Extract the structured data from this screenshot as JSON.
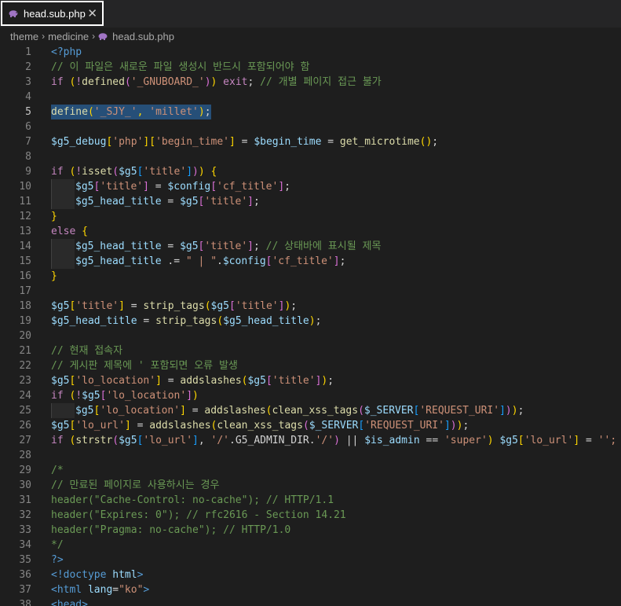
{
  "tab": {
    "filename": "head.sub.php",
    "icon": "php-elephant-icon",
    "close_glyph": "✕"
  },
  "breadcrumb": {
    "items": [
      "theme",
      "medicine",
      "head.sub.php"
    ],
    "separator": "›"
  },
  "editor": {
    "active_line": 5,
    "lines": [
      {
        "n": "1",
        "tokens": [
          [
            "<?php",
            "tag"
          ]
        ]
      },
      {
        "n": "2",
        "tokens": [
          [
            "// 이 파일은 새로운 파일 생성시 반드시 포함되어야 함",
            "cmt"
          ]
        ]
      },
      {
        "n": "3",
        "tokens": [
          [
            "if",
            "kw"
          ],
          [
            " ",
            ""
          ],
          [
            "(",
            "y"
          ],
          [
            "!",
            "kw"
          ],
          [
            "defined",
            "fn"
          ],
          [
            "(",
            "p"
          ],
          [
            "'_GNUBOARD_'",
            "str"
          ],
          [
            ")",
            "p"
          ],
          [
            ")",
            "y"
          ],
          [
            " ",
            ""
          ],
          [
            "exit",
            "kw"
          ],
          [
            "; ",
            ""
          ],
          [
            "// 개별 페이지 접근 불가",
            "cmt"
          ]
        ]
      },
      {
        "n": "4",
        "tokens": []
      },
      {
        "n": "5",
        "tokens": [
          [
            "define",
            "fn"
          ],
          [
            "(",
            "y"
          ],
          [
            "'_SJY_'",
            "str"
          ],
          [
            ",",
            "y"
          ],
          [
            " ",
            ""
          ],
          [
            "'millet'",
            "str"
          ],
          [
            ")",
            "y"
          ],
          [
            ";",
            ""
          ]
        ],
        "selected": true
      },
      {
        "n": "6",
        "tokens": []
      },
      {
        "n": "7",
        "tokens": [
          [
            "$g5_debug",
            "var"
          ],
          [
            "[",
            "y"
          ],
          [
            "'php'",
            "str"
          ],
          [
            "]",
            "y"
          ],
          [
            "[",
            "y"
          ],
          [
            "'begin_time'",
            "str"
          ],
          [
            "]",
            "y"
          ],
          [
            " = ",
            ""
          ],
          [
            "$begin_time",
            "var"
          ],
          [
            " = ",
            ""
          ],
          [
            "get_microtime",
            "fn"
          ],
          [
            "()",
            "y"
          ],
          [
            ";",
            ""
          ]
        ]
      },
      {
        "n": "8",
        "tokens": []
      },
      {
        "n": "9",
        "tokens": [
          [
            "if",
            "kw"
          ],
          [
            " ",
            ""
          ],
          [
            "(",
            "y"
          ],
          [
            "!",
            "kw"
          ],
          [
            "isset",
            "fn"
          ],
          [
            "(",
            "p"
          ],
          [
            "$g5",
            "var"
          ],
          [
            "[",
            "b"
          ],
          [
            "'title'",
            "str"
          ],
          [
            "]",
            "b"
          ],
          [
            ")",
            "p"
          ],
          [
            ")",
            "y"
          ],
          [
            " ",
            ""
          ],
          [
            "{",
            "y"
          ]
        ]
      },
      {
        "n": "10",
        "indent": 1,
        "tokens": [
          [
            "$g5",
            "var"
          ],
          [
            "[",
            "p"
          ],
          [
            "'title'",
            "str"
          ],
          [
            "]",
            "p"
          ],
          [
            " = ",
            ""
          ],
          [
            "$config",
            "var"
          ],
          [
            "[",
            "p"
          ],
          [
            "'cf_title'",
            "str"
          ],
          [
            "]",
            "p"
          ],
          [
            ";",
            ""
          ]
        ]
      },
      {
        "n": "11",
        "indent": 1,
        "tokens": [
          [
            "$g5_head_title",
            "var"
          ],
          [
            " = ",
            ""
          ],
          [
            "$g5",
            "var"
          ],
          [
            "[",
            "p"
          ],
          [
            "'title'",
            "str"
          ],
          [
            "]",
            "p"
          ],
          [
            ";",
            ""
          ]
        ]
      },
      {
        "n": "12",
        "tokens": [
          [
            "}",
            "y"
          ]
        ]
      },
      {
        "n": "13",
        "tokens": [
          [
            "else",
            "kw"
          ],
          [
            " ",
            ""
          ],
          [
            "{",
            "y"
          ]
        ]
      },
      {
        "n": "14",
        "indent": 1,
        "tokens": [
          [
            "$g5_head_title",
            "var"
          ],
          [
            " = ",
            ""
          ],
          [
            "$g5",
            "var"
          ],
          [
            "[",
            "p"
          ],
          [
            "'title'",
            "str"
          ],
          [
            "]",
            "p"
          ],
          [
            "; ",
            ""
          ],
          [
            "// 상태바에 표시될 제목",
            "cmt"
          ]
        ]
      },
      {
        "n": "15",
        "indent": 1,
        "tokens": [
          [
            "$g5_head_title",
            "var"
          ],
          [
            " .= ",
            ""
          ],
          [
            "\" | \"",
            "str"
          ],
          [
            ".",
            ""
          ],
          [
            "$config",
            "var"
          ],
          [
            "[",
            "p"
          ],
          [
            "'cf_title'",
            "str"
          ],
          [
            "]",
            "p"
          ],
          [
            ";",
            ""
          ]
        ]
      },
      {
        "n": "16",
        "tokens": [
          [
            "}",
            "y"
          ]
        ]
      },
      {
        "n": "17",
        "tokens": []
      },
      {
        "n": "18",
        "tokens": [
          [
            "$g5",
            "var"
          ],
          [
            "[",
            "y"
          ],
          [
            "'title'",
            "str"
          ],
          [
            "]",
            "y"
          ],
          [
            " = ",
            ""
          ],
          [
            "strip_tags",
            "fn"
          ],
          [
            "(",
            "y"
          ],
          [
            "$g5",
            "var"
          ],
          [
            "[",
            "p"
          ],
          [
            "'title'",
            "str"
          ],
          [
            "]",
            "p"
          ],
          [
            ")",
            "y"
          ],
          [
            ";",
            ""
          ]
        ]
      },
      {
        "n": "19",
        "tokens": [
          [
            "$g5_head_title",
            "var"
          ],
          [
            " = ",
            ""
          ],
          [
            "strip_tags",
            "fn"
          ],
          [
            "(",
            "y"
          ],
          [
            "$g5_head_title",
            "var"
          ],
          [
            ")",
            "y"
          ],
          [
            ";",
            ""
          ]
        ]
      },
      {
        "n": "20",
        "tokens": []
      },
      {
        "n": "21",
        "tokens": [
          [
            "// 현재 접속자",
            "cmt"
          ]
        ]
      },
      {
        "n": "22",
        "tokens": [
          [
            "// 게시판 제목에 ' 포함되면 오류 발생",
            "cmt"
          ]
        ]
      },
      {
        "n": "23",
        "tokens": [
          [
            "$g5",
            "var"
          ],
          [
            "[",
            "y"
          ],
          [
            "'lo_location'",
            "str"
          ],
          [
            "]",
            "y"
          ],
          [
            " = ",
            ""
          ],
          [
            "addslashes",
            "fn"
          ],
          [
            "(",
            "y"
          ],
          [
            "$g5",
            "var"
          ],
          [
            "[",
            "p"
          ],
          [
            "'title'",
            "str"
          ],
          [
            "]",
            "p"
          ],
          [
            ")",
            "y"
          ],
          [
            ";",
            ""
          ]
        ]
      },
      {
        "n": "24",
        "tokens": [
          [
            "if",
            "kw"
          ],
          [
            " ",
            ""
          ],
          [
            "(",
            "y"
          ],
          [
            "!",
            "kw"
          ],
          [
            "$g5",
            "var"
          ],
          [
            "[",
            "p"
          ],
          [
            "'lo_location'",
            "str"
          ],
          [
            "]",
            "p"
          ],
          [
            ")",
            "y"
          ]
        ]
      },
      {
        "n": "25",
        "indent": 1,
        "tokens": [
          [
            "$g5",
            "var"
          ],
          [
            "[",
            "y"
          ],
          [
            "'lo_location'",
            "str"
          ],
          [
            "]",
            "y"
          ],
          [
            " = ",
            ""
          ],
          [
            "addslashes",
            "fn"
          ],
          [
            "(",
            "y"
          ],
          [
            "clean_xss_tags",
            "fn"
          ],
          [
            "(",
            "p"
          ],
          [
            "$_SERVER",
            "var"
          ],
          [
            "[",
            "b"
          ],
          [
            "'REQUEST_URI'",
            "str"
          ],
          [
            "]",
            "b"
          ],
          [
            ")",
            "p"
          ],
          [
            ")",
            "y"
          ],
          [
            ";",
            ""
          ]
        ]
      },
      {
        "n": "26",
        "tokens": [
          [
            "$g5",
            "var"
          ],
          [
            "[",
            "y"
          ],
          [
            "'lo_url'",
            "str"
          ],
          [
            "]",
            "y"
          ],
          [
            " = ",
            ""
          ],
          [
            "addslashes",
            "fn"
          ],
          [
            "(",
            "y"
          ],
          [
            "clean_xss_tags",
            "fn"
          ],
          [
            "(",
            "p"
          ],
          [
            "$_SERVER",
            "var"
          ],
          [
            "[",
            "b"
          ],
          [
            "'REQUEST_URI'",
            "str"
          ],
          [
            "]",
            "b"
          ],
          [
            ")",
            "p"
          ],
          [
            ")",
            "y"
          ],
          [
            ";",
            ""
          ]
        ]
      },
      {
        "n": "27",
        "tokens": [
          [
            "if",
            "kw"
          ],
          [
            " ",
            ""
          ],
          [
            "(",
            "y"
          ],
          [
            "strstr",
            "fn"
          ],
          [
            "(",
            "p"
          ],
          [
            "$g5",
            "var"
          ],
          [
            "[",
            "b"
          ],
          [
            "'lo_url'",
            "str"
          ],
          [
            "]",
            "b"
          ],
          [
            ", ",
            ""
          ],
          [
            "'/'",
            "str"
          ],
          [
            ".G5_ADMIN_DIR.",
            ""
          ],
          [
            "'/'",
            "str"
          ],
          [
            ")",
            "p"
          ],
          [
            " || ",
            ""
          ],
          [
            "$is_admin",
            "var"
          ],
          [
            " == ",
            ""
          ],
          [
            "'super'",
            "str"
          ],
          [
            ")",
            "y"
          ],
          [
            " ",
            ""
          ],
          [
            "$g5",
            "var"
          ],
          [
            "[",
            "y"
          ],
          [
            "'lo_url'",
            "str"
          ],
          [
            "]",
            "y"
          ],
          [
            " = ",
            ""
          ],
          [
            "'';",
            "str"
          ]
        ]
      },
      {
        "n": "28",
        "tokens": []
      },
      {
        "n": "29",
        "tokens": [
          [
            "/*",
            "cmt"
          ]
        ]
      },
      {
        "n": "30",
        "tokens": [
          [
            "// 만료된 페이지로 사용하시는 경우",
            "cmt"
          ]
        ]
      },
      {
        "n": "31",
        "tokens": [
          [
            "header(\"Cache-Control: no-cache\"); // HTTP/1.1",
            "cmt"
          ]
        ]
      },
      {
        "n": "32",
        "tokens": [
          [
            "header(\"Expires: 0\"); // rfc2616 - Section 14.21",
            "cmt"
          ]
        ]
      },
      {
        "n": "33",
        "tokens": [
          [
            "header(\"Pragma: no-cache\"); // HTTP/1.0",
            "cmt"
          ]
        ]
      },
      {
        "n": "34",
        "tokens": [
          [
            "*/",
            "cmt"
          ]
        ]
      },
      {
        "n": "35",
        "tokens": [
          [
            "?>",
            "tag"
          ]
        ]
      },
      {
        "n": "36",
        "tokens": [
          [
            "<!",
            "tag"
          ],
          [
            "doctype",
            "tag"
          ],
          [
            " ",
            ""
          ],
          [
            "html",
            "var"
          ],
          [
            ">",
            "tag"
          ]
        ]
      },
      {
        "n": "37",
        "tokens": [
          [
            "<",
            "tag"
          ],
          [
            "html",
            "tag"
          ],
          [
            " ",
            ""
          ],
          [
            "lang",
            "var"
          ],
          [
            "=",
            ""
          ],
          [
            "\"ko\"",
            "str"
          ],
          [
            ">",
            "tag"
          ]
        ]
      },
      {
        "n": "38",
        "tokens": [
          [
            "<",
            "tag"
          ],
          [
            "head",
            "tag"
          ],
          [
            ">",
            "tag"
          ]
        ]
      }
    ]
  },
  "colors": {
    "background": "#1e1e1e",
    "selection": "#264f78",
    "comment": "#6a9955",
    "keyword": "#c586c0",
    "function": "#dcdcaa",
    "string": "#ce9178",
    "variable": "#9cdcfe"
  }
}
